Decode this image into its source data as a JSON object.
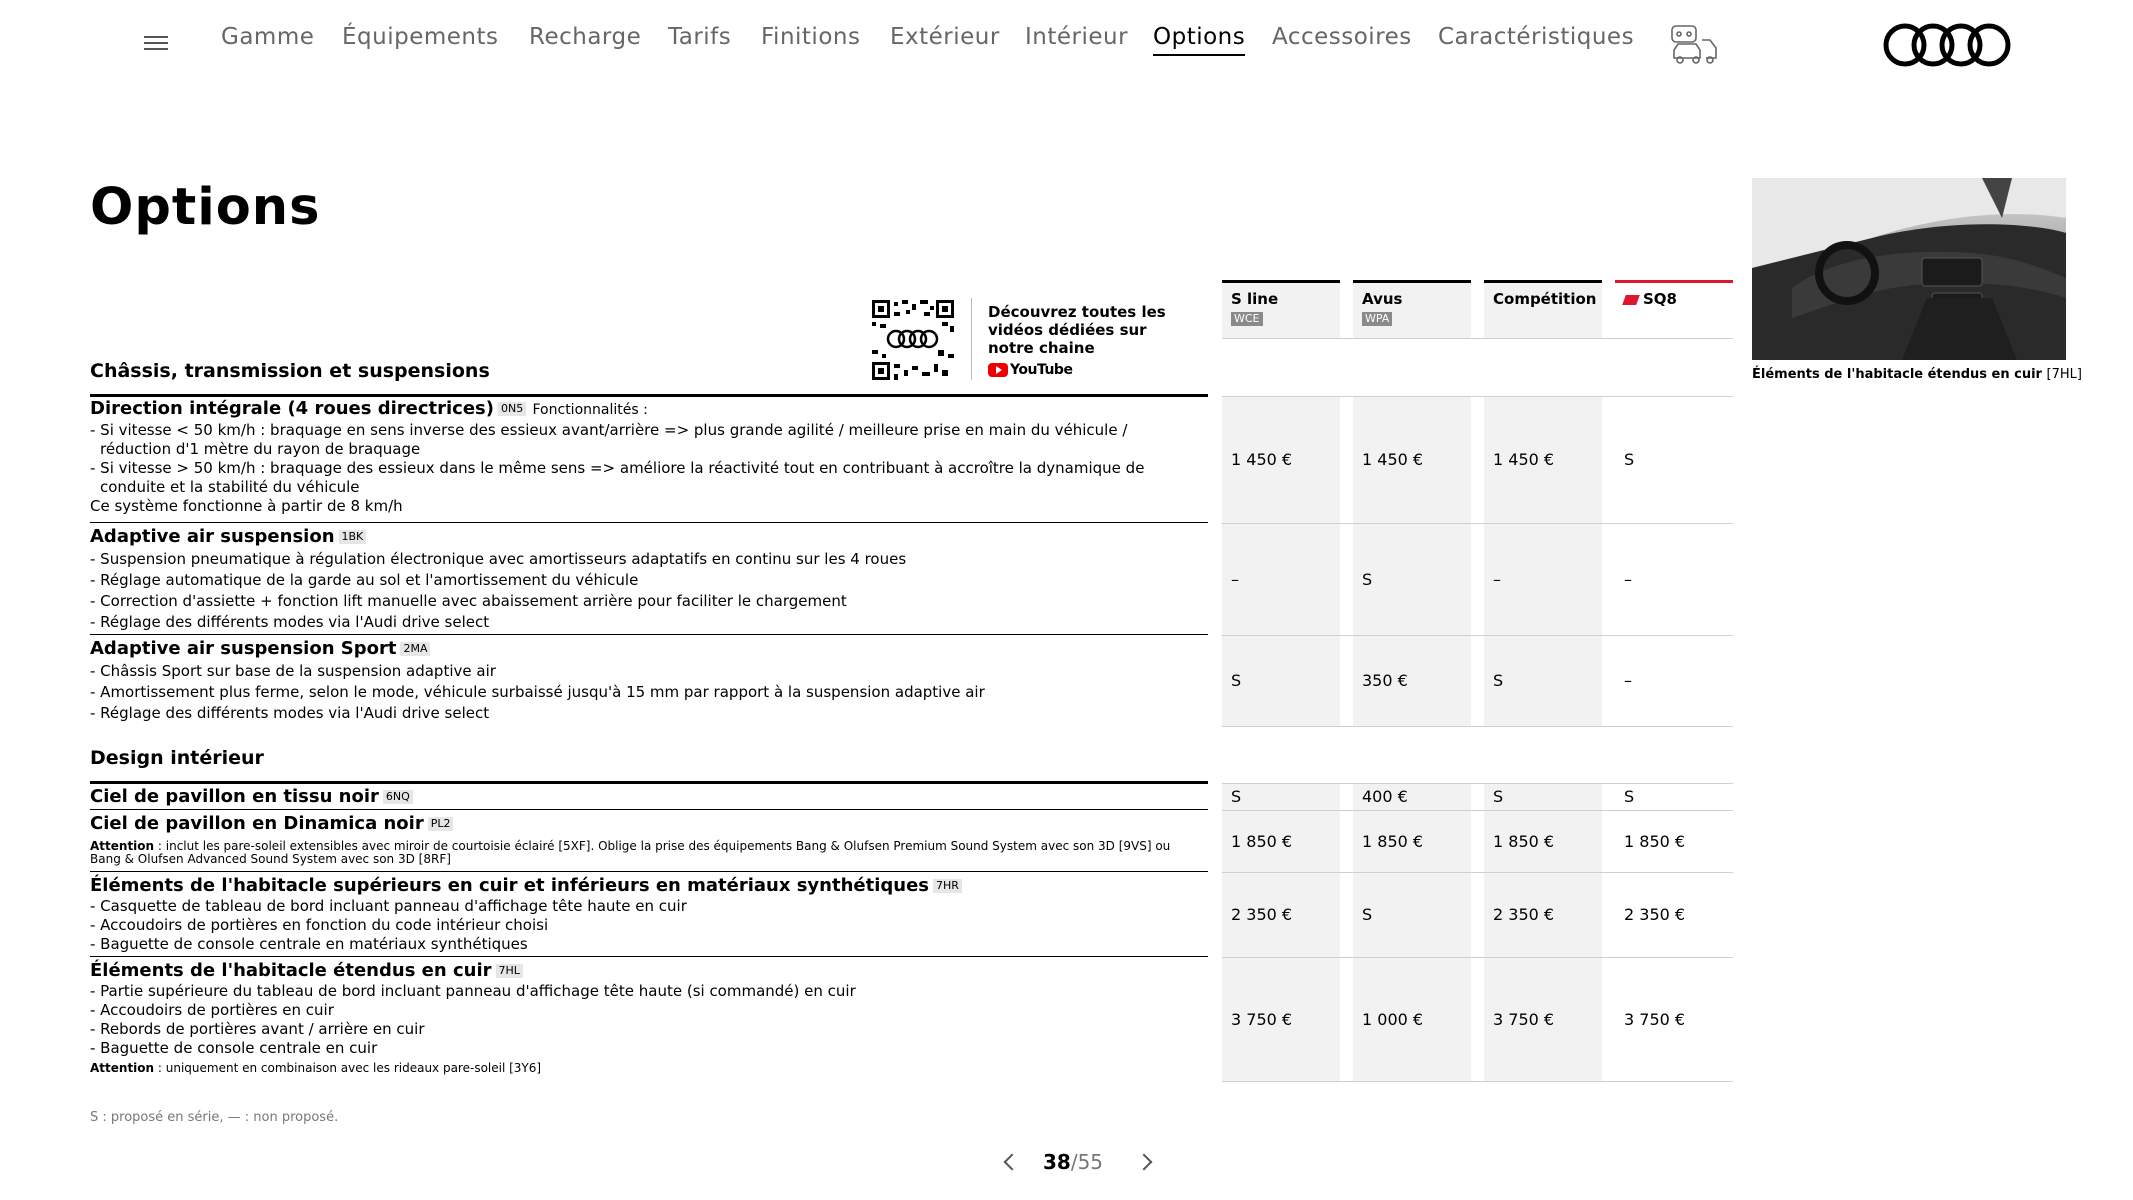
{
  "nav": {
    "items": [
      "Gamme",
      "Équipements",
      "Recharge",
      "Tarifs",
      "Finitions",
      "Extérieur",
      "Intérieur",
      "Options",
      "Accessoires",
      "Caractéristiques"
    ],
    "active": "Options",
    "icons": {
      "menu": "hamburger-menu-icon",
      "configurator": "configurator-icon",
      "brand": "audi-rings-logo"
    }
  },
  "page": {
    "title": "Options"
  },
  "promo": {
    "text": "Découvrez toutes les vidéos dédiées sur notre chaine",
    "youtube": "YouTube"
  },
  "columns": [
    {
      "name": "S line",
      "code": "WCE"
    },
    {
      "name": "Avus",
      "code": "WPA"
    },
    {
      "name": "Compétition",
      "code": ""
    },
    {
      "name": "SQ8",
      "code": "",
      "accent": "#e0162b"
    }
  ],
  "sections": [
    {
      "title": "Châssis, transmission et suspensions",
      "rows": [
        {
          "title": "Direction intégrale (4 roues directrices)",
          "code": "0N5",
          "inline": "Fonctionnalités :",
          "lines": [
            "- Si vitesse < 50 km/h : braquage en sens inverse des essieux avant/arrière => plus grande agilité / meilleure prise en main du véhicule /",
            "réduction d'1 mètre du rayon de braquage",
            "- Si vitesse > 50 km/h : braquage des essieux dans le même sens => améliore la réactivité tout en contribuant à accroître la dynamique de",
            "conduite et la stabilité du véhicule",
            "Ce système fonctionne à partir de 8 km/h"
          ],
          "values": [
            "1 450 €",
            "1 450 €",
            "1 450 €",
            "S"
          ]
        },
        {
          "title": "Adaptive air suspension",
          "code": "1BK",
          "lines": [
            "- Suspension pneumatique à régulation électronique avec amortisseurs adaptatifs en continu sur les 4 roues",
            "- Réglage automatique de la garde au sol et l'amortissement du véhicule",
            "- Correction d'assiette + fonction lift manuelle avec abaissement arrière pour faciliter le chargement",
            "- Réglage des différents modes via l'Audi drive select"
          ],
          "values": [
            "–",
            "S",
            "–",
            "–"
          ]
        },
        {
          "title": "Adaptive air suspension Sport",
          "code": "2MA",
          "lines": [
            "- Châssis Sport sur base de la suspension adaptive air",
            "- Amortissement plus ferme, selon le mode, véhicule surbaissé jusqu'à 15 mm par rapport à la suspension adaptive air",
            "- Réglage des différents modes via l'Audi drive select"
          ],
          "values": [
            "S",
            "350 €",
            "S",
            "–"
          ]
        }
      ]
    },
    {
      "title": "Design intérieur",
      "rows": [
        {
          "title": "Ciel de pavillon en tissu noir",
          "code": "6NQ",
          "values": [
            "S",
            "400 €",
            "S",
            "S"
          ]
        },
        {
          "title": "Ciel de pavillon en Dinamica noir",
          "code": "PL2",
          "note_label": "Attention",
          "note": " : inclut les pare-soleil extensibles avec miroir de courtoisie éclairé [5XF]. Oblige la prise des équipements Bang & Olufsen Premium Sound System avec son 3D [9VS] ou Bang & Olufsen Advanced Sound System avec son 3D [8RF]",
          "values": [
            "1 850 €",
            "1 850 €",
            "1 850 €",
            "1 850 €"
          ]
        },
        {
          "title": "Éléments de l'habitacle supérieurs en cuir et inférieurs en matériaux synthétiques",
          "code": "7HR",
          "lines": [
            "- Casquette de tableau de bord incluant panneau d'affichage tête haute en cuir",
            "- Accoudoirs de portières en fonction du code intérieur choisi",
            "- Baguette de console centrale en matériaux synthétiques"
          ],
          "values": [
            "2 350 €",
            "S",
            "2 350 €",
            "2 350 €"
          ]
        },
        {
          "title": "Éléments de l'habitacle étendus en cuir",
          "code": "7HL",
          "lines": [
            "- Partie supérieure du tableau de bord incluant panneau d'affichage tête haute (si commandé) en cuir",
            "- Accoudoirs de portières en cuir",
            "- Rebords de portières avant / arrière en cuir",
            "- Baguette de console centrale en cuir"
          ],
          "note_label": "Attention",
          "note": " : uniquement en combinaison avec les rideaux pare-soleil [3Y6]",
          "values": [
            "3 750 €",
            "1 000 €",
            "3 750 €",
            "3 750 €"
          ]
        }
      ]
    }
  ],
  "image": {
    "caption": "Éléments de l'habitacle étendus en cuir",
    "caption_code": "[7HL]"
  },
  "legend": "S : proposé en série, — : non proposé.",
  "pager": {
    "current": "38",
    "total": "/55"
  }
}
